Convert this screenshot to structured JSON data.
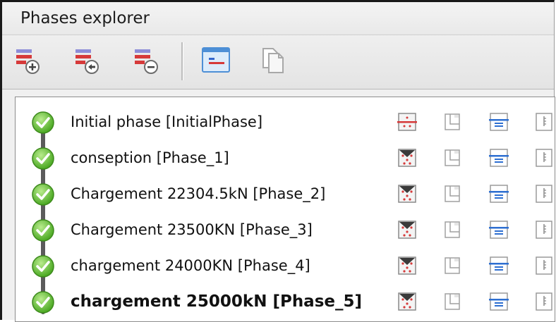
{
  "panel": {
    "title": "Phases explorer"
  },
  "toolbar": {
    "buttons": [
      {
        "name": "add-phase-button",
        "icon": "add-phase-icon"
      },
      {
        "name": "insert-phase-button",
        "icon": "insert-phase-icon"
      },
      {
        "name": "delete-phase-button",
        "icon": "delete-phase-icon"
      },
      {
        "name": "phase-view-button",
        "icon": "phase-view-icon"
      },
      {
        "name": "copy-phase-button",
        "icon": "copy-icon"
      }
    ]
  },
  "phases": [
    {
      "label": "Initial phase [InitialPhase]",
      "status": "calculated",
      "selected": false
    },
    {
      "label": "conseption [Phase_1]",
      "status": "calculated",
      "selected": false
    },
    {
      "label": "Chargement 22304.5kN [Phase_2]",
      "status": "calculated",
      "selected": false
    },
    {
      "label": "Chargement 23500KN [Phase_3]",
      "status": "calculated",
      "selected": false
    },
    {
      "label": "chargement 24000KN [Phase_4]",
      "status": "calculated",
      "selected": false
    },
    {
      "label": "chargement 25000kN [Phase_5]",
      "status": "calculated",
      "selected": true
    }
  ],
  "colors": {
    "status_green": "#5cbf2a",
    "accent_red": "#d63a3a",
    "accent_blue": "#2e6fd1"
  }
}
